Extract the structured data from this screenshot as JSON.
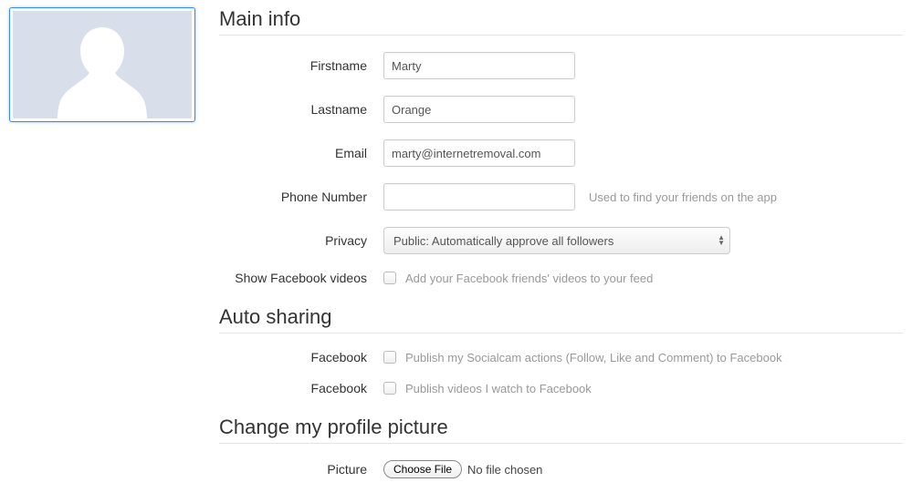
{
  "sections": {
    "main_info": "Main info",
    "auto_sharing": "Auto sharing",
    "change_picture": "Change my profile picture"
  },
  "fields": {
    "firstname": {
      "label": "Firstname",
      "value": "Marty"
    },
    "lastname": {
      "label": "Lastname",
      "value": "Orange"
    },
    "email": {
      "label": "Email",
      "value": "marty@internetremoval.com"
    },
    "phone": {
      "label": "Phone Number",
      "value": "",
      "hint": "Used to find your friends on the app"
    },
    "privacy": {
      "label": "Privacy",
      "value": "Public: Automatically approve all followers"
    },
    "show_fb_videos": {
      "label": "Show Facebook videos",
      "desc": "Add your Facebook friends' videos to your feed"
    },
    "facebook1": {
      "label": "Facebook",
      "desc": "Publish my Socialcam actions (Follow, Like and Comment) to Facebook"
    },
    "facebook2": {
      "label": "Facebook",
      "desc": "Publish videos I watch to Facebook"
    },
    "picture": {
      "label": "Picture",
      "button": "Choose File",
      "status": "No file chosen"
    }
  }
}
